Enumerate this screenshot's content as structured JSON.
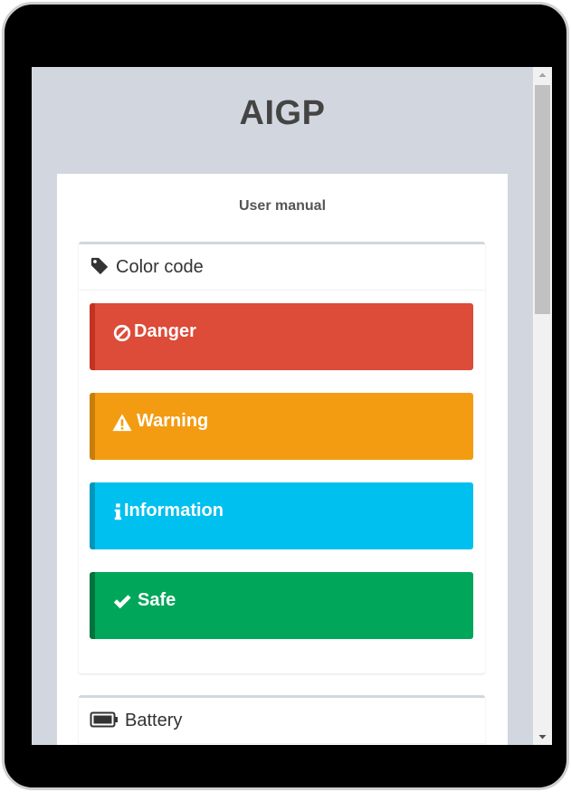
{
  "app": {
    "title": "AIGP"
  },
  "manual": {
    "title": "User manual"
  },
  "color_code": {
    "title": "Color code",
    "icon": "tag-icon",
    "items": [
      {
        "label": "Danger",
        "icon": "ban-icon",
        "color": "#dd4b39"
      },
      {
        "label": "Warning",
        "icon": "warning-icon",
        "color": "#f39c12"
      },
      {
        "label": "Information",
        "icon": "info-icon",
        "color": "#00c0ef"
      },
      {
        "label": "Safe",
        "icon": "check-icon",
        "color": "#00a65a"
      }
    ]
  },
  "battery": {
    "title": "Battery",
    "icon": "battery-icon"
  },
  "colors": {
    "background": "#d2d6de",
    "panel": "#ffffff",
    "device_frame": "#000000"
  }
}
